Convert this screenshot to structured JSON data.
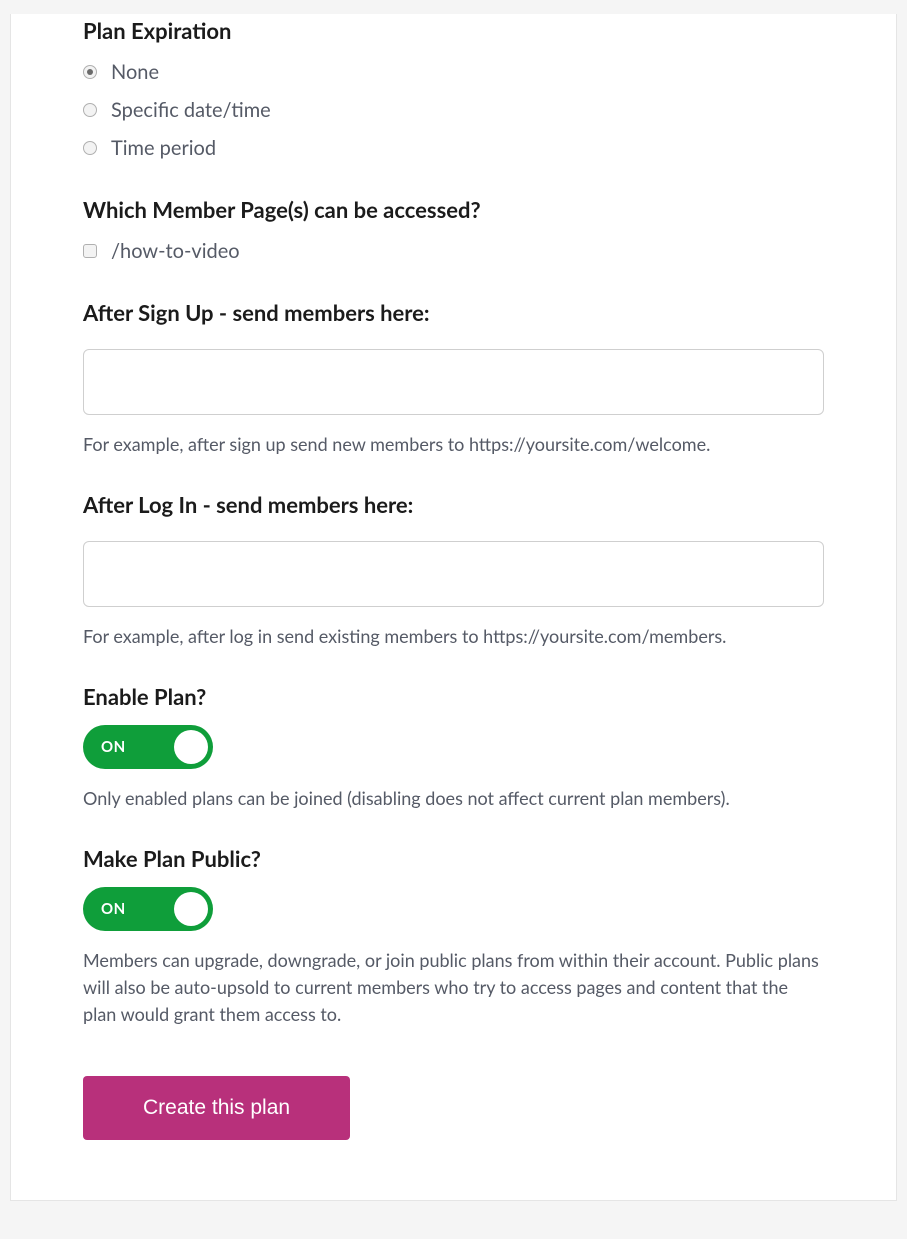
{
  "planExpiration": {
    "title": "Plan Expiration",
    "options": {
      "none": "None",
      "specific": "Specific date/time",
      "period": "Time period"
    },
    "selected": "none"
  },
  "memberPages": {
    "title": "Which Member Page(s) can be accessed?",
    "items": [
      {
        "label": "/how-to-video",
        "checked": false
      }
    ]
  },
  "afterSignup": {
    "title": "After Sign Up - send members here:",
    "value": "",
    "helper": "For example, after sign up send new members to https://yoursite.com/welcome."
  },
  "afterLogin": {
    "title": "After Log In - send members here:",
    "value": "",
    "helper": "For example, after log in send existing members to https://yoursite.com/members."
  },
  "enablePlan": {
    "title": "Enable Plan?",
    "state": "ON",
    "helper": "Only enabled plans can be joined (disabling does not affect current plan members)."
  },
  "makePublic": {
    "title": "Make Plan Public?",
    "state": "ON",
    "helper": "Members can upgrade, downgrade, or join public plans from within their account. Public plans will also be auto-upsold to current members who try to access pages and content that the plan would grant them access to."
  },
  "submit": {
    "label": "Create this plan"
  }
}
